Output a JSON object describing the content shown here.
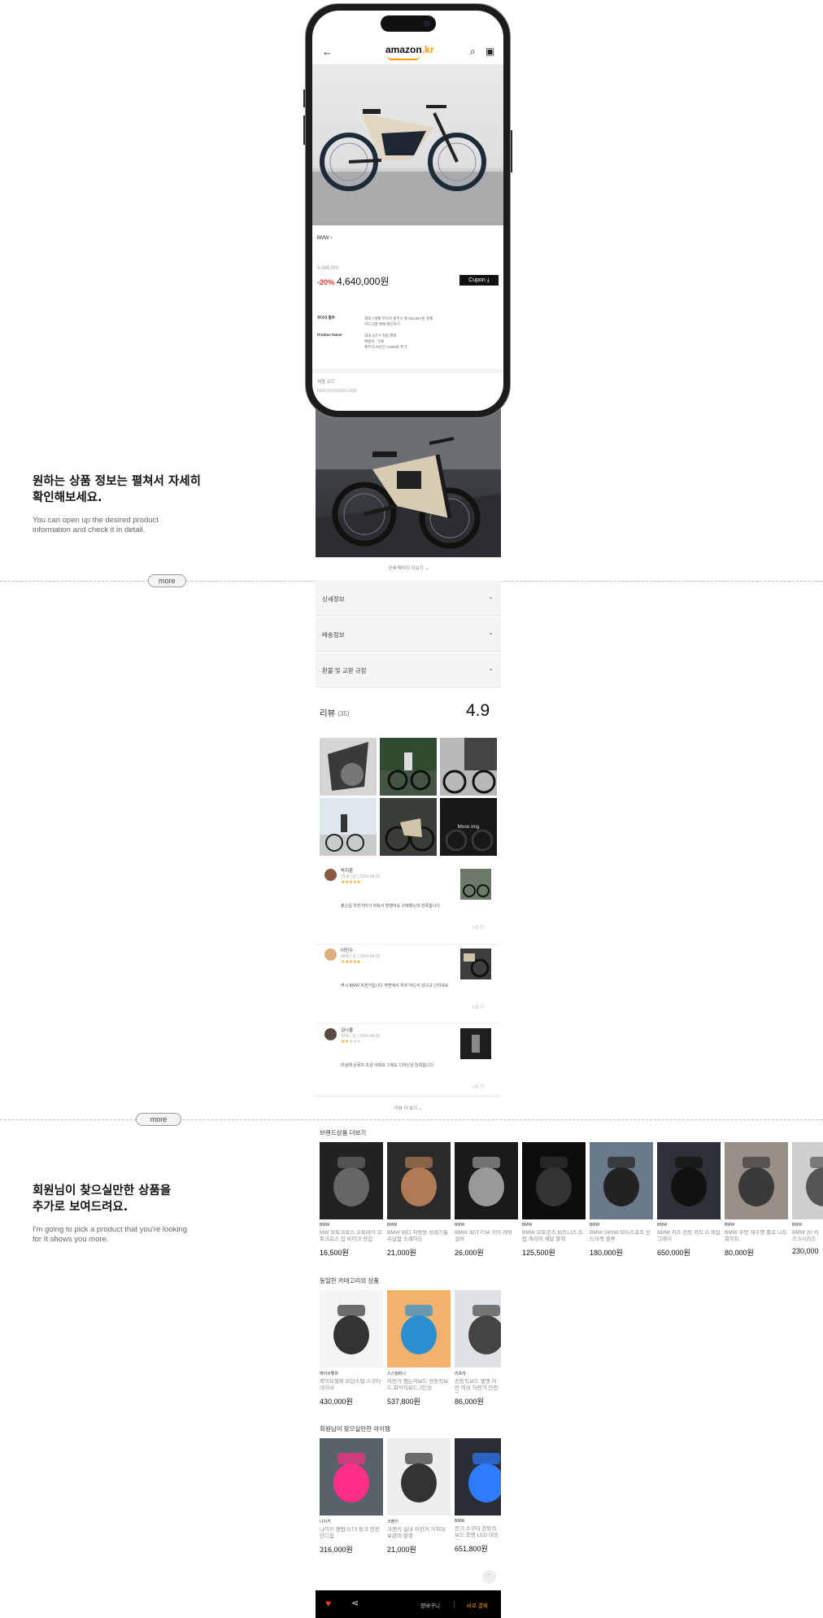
{
  "feature1": {
    "title": "원하는 상품 정보는 펼쳐서 자세히\n확인해보세요.",
    "desc": "You can open up the desired product\ninformation and check it in detail.",
    "more": "more"
  },
  "feature2": {
    "title": "회원님이 찾으실만한 상품을\n추가로 보여드려요.",
    "desc": "I'm going to pick a product that you're looking\nfor It shows you more.",
    "more": "more"
  },
  "app": {
    "logo_main": "amazon",
    "logo_tld": ".kr"
  },
  "product": {
    "brand": "BMW",
    "original_price": "5,568,000",
    "discount": "-20%",
    "price": "4,640,000원",
    "coupon": "Cupon",
    "info": [
      {
        "label": "무이자 할부",
        "value": "최대 7개월 무이자 할부시 월 662,857원 결제\n카드사별 혜택 확인하기"
      },
      {
        "label": "Product Name",
        "value": "최대 2만 P 적립 혜택\n배송비 : 무료\n제주/도서산간 4,000원 추가"
      }
    ],
    "code_label": "제품 코드",
    "code_value": "BAR1KFS5606510N0"
  },
  "detail": {
    "expand_label": "상세 페이지 더보기"
  },
  "accordions": [
    {
      "label": "상세정보"
    },
    {
      "label": "배송정보"
    },
    {
      "label": "환불 및 교환 규정"
    }
  ],
  "reviews": {
    "title": "리뷰",
    "count": "(35)",
    "score": "4.9",
    "more_img": "More img",
    "items": [
      {
        "name": "박지훈",
        "meta": "25세 | 남 | 2024-08-02",
        "stars": "★★★★★",
        "stars_off": "",
        "text": "출근길 자전거타기 쉬워서 편했어요 구매했는데 만족합니다"
      },
      {
        "name": "이민수",
        "meta": "28세 | 남 | 2024-08-02",
        "stars": "★★★★★",
        "stars_off": "",
        "text": "역시 BMW 자전거입니다 주변에서 자꾸 어디서 샀냐고 난리네요"
      },
      {
        "name": "김나율",
        "meta": "30세 | 남 | 2024-08-02",
        "stars": "★★",
        "stars_off": "★★★",
        "text": "타실때 손목이 조금 아파요 그래도 디자인은 만족합니다"
      }
    ],
    "more_label": "리뷰 더 보기"
  },
  "brand_section": {
    "title": "브랜드상품 더보기",
    "items": [
      {
        "brand": "BMW",
        "name": "MW 모토크로스 오토바이 모토크로스 집 바이크 장갑",
        "price": "16,500원"
      },
      {
        "brand": "BMW",
        "name": "BMW 바디 차량용 쓰레기통 수납함 스레이드",
        "price": "21,000원"
      },
      {
        "brand": "BMW",
        "name": "BMW 3GT F34 기어 커버 실버",
        "price": "26,000원"
      },
      {
        "brand": "BMW",
        "name": "BMW 모토굿즈 비즈니스 트립 캐리어 세달 블랙",
        "price": "125,500원"
      },
      {
        "brand": "BMW",
        "name": "BMW 24SW 모터스포츠 선드자켓 블루",
        "price": "180,000원"
      },
      {
        "brand": "BMW",
        "name": "BMW 키즈 전동 카트 i5 에일 그레이",
        "price": "650,000원"
      },
      {
        "brand": "BMW",
        "name": "BMW 우먼 제주명 롤로 니트 화이트",
        "price": "80,000원"
      },
      {
        "brand": "BMW",
        "name": "BMW 20 키즈 5시리즈",
        "price": "230,000"
      }
    ]
  },
  "category_section": {
    "title": "동일한 카테고리의 상품",
    "items": [
      {
        "brand": "에이브헬퍼",
        "name": "퀵이브헬퍼 모던스탈 스쿠터 네이비",
        "price": "430,000원"
      },
      {
        "brand": "스스컴퍼니",
        "name": "자전거 캠는자보드 전동킥보드 화식킥보드 2인승",
        "price": "537,800원"
      },
      {
        "brand": "라프라",
        "name": "전동킥보드 헬멧 어반 여성 자전거 안전모",
        "price": "86,000원"
      }
    ]
  },
  "recommend_section": {
    "title": "회원님이 찾으실만한 아이템",
    "items": [
      {
        "brand": "나이키",
        "name": "나이키 팬텀 GT3 핑크 안전인디움",
        "price": "316,000원"
      },
      {
        "brand": "크랜키",
        "name": "크랜키 실내 자전거 거치대 보관대 블랙",
        "price": "21,000원"
      },
      {
        "brand": "BMW",
        "name": "전기 스쿠터 전동킥보드 조명 LED 대응고",
        "price": "651,800원"
      }
    ]
  },
  "bottom_bar": {
    "cart": "장바구니",
    "buy": "바로 결제"
  }
}
